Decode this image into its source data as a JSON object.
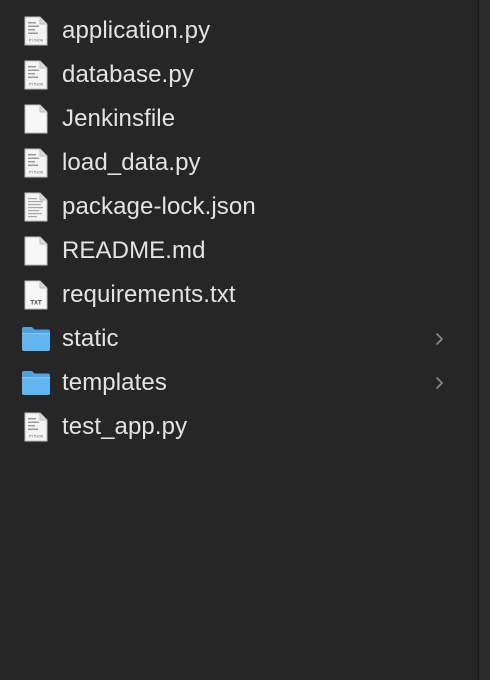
{
  "files": [
    {
      "name": "application.py",
      "icon": "python-file-icon",
      "kind": "file"
    },
    {
      "name": "database.py",
      "icon": "python-file-icon",
      "kind": "file"
    },
    {
      "name": "Jenkinsfile",
      "icon": "blank-document-icon",
      "kind": "file"
    },
    {
      "name": "load_data.py",
      "icon": "python-file-icon",
      "kind": "file"
    },
    {
      "name": "package-lock.json",
      "icon": "text-document-icon",
      "kind": "file"
    },
    {
      "name": "README.md",
      "icon": "blank-document-icon",
      "kind": "file"
    },
    {
      "name": "requirements.txt",
      "icon": "txt-file-icon",
      "kind": "file"
    },
    {
      "name": "static",
      "icon": "folder-icon",
      "kind": "folder"
    },
    {
      "name": "templates",
      "icon": "folder-icon",
      "kind": "folder"
    },
    {
      "name": "test_app.py",
      "icon": "python-file-icon",
      "kind": "file"
    }
  ],
  "icon_labels": {
    "python": "PYTHON",
    "txt": "TXT"
  },
  "colors": {
    "background": "#262626",
    "text": "#e3e3e3",
    "folder": "#5eb3ee",
    "chevron": "#8a8a8a"
  }
}
